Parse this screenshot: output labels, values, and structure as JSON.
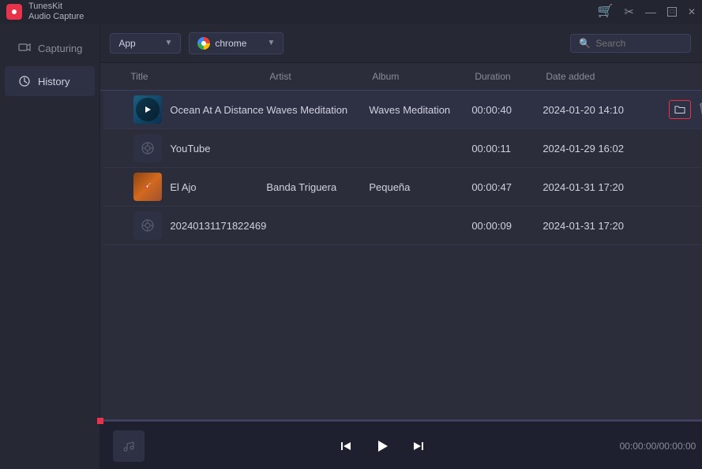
{
  "app": {
    "name": "TunesKit",
    "subtitle": "Audio Capture",
    "icon_label": "TK"
  },
  "titlebar": {
    "cart_icon": "🛒",
    "scissors_icon": "✂",
    "minimize_icon": "—",
    "maximize_icon": "□",
    "close_icon": "✕"
  },
  "sidebar": {
    "items": [
      {
        "id": "capturing",
        "label": "Capturing",
        "icon": "⊞"
      },
      {
        "id": "history",
        "label": "History",
        "icon": "🕐",
        "active": true
      }
    ]
  },
  "toolbar": {
    "source_label": "App",
    "browser_label": "chrome",
    "search_placeholder": "Search"
  },
  "table": {
    "headers": [
      "",
      "Title",
      "Artist",
      "Album",
      "Duration",
      "Date added",
      ""
    ],
    "rows": [
      {
        "id": 1,
        "thumb_type": "ocean",
        "title": "Ocean At A Distance",
        "artist": "Waves Meditation",
        "album": "Waves Meditation",
        "duration": "00:00:40",
        "date_added": "2024-01-20 14:10",
        "selected": true,
        "has_actions": true
      },
      {
        "id": 2,
        "thumb_type": "music",
        "title": "YouTube",
        "artist": "",
        "album": "",
        "duration": "00:00:11",
        "date_added": "2024-01-29 16:02",
        "selected": false,
        "has_actions": false
      },
      {
        "id": 3,
        "thumb_type": "elajo",
        "title": "El Ajo",
        "artist": "Banda Triguera",
        "album": "Pequeña",
        "duration": "00:00:47",
        "date_added": "2024-01-31 17:20",
        "selected": false,
        "has_actions": false
      },
      {
        "id": 4,
        "thumb_type": "music",
        "title": "20240131171822469",
        "artist": "",
        "album": "",
        "duration": "00:00:09",
        "date_added": "2024-01-31 17:20",
        "selected": false,
        "has_actions": false
      }
    ]
  },
  "player": {
    "time_display": "00:00:00/00:00:00",
    "music_note": "♪"
  }
}
